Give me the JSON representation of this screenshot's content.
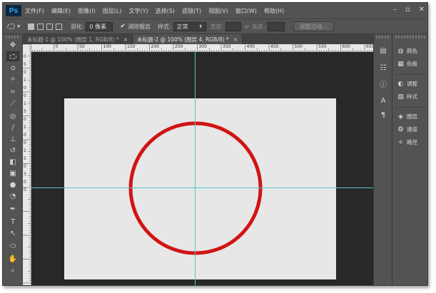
{
  "app": {
    "logo_text": "Ps"
  },
  "menubar": {
    "items": [
      "文件(F)",
      "编辑(E)",
      "图像(I)",
      "图层(L)",
      "文字(Y)",
      "选择(S)",
      "滤镜(T)",
      "视图(V)",
      "窗口(W)",
      "帮助(H)"
    ],
    "controls": {
      "minimize": "–",
      "restore": "▫",
      "close": "✕"
    }
  },
  "options": {
    "feather_label": "羽化:",
    "feather_value": "0 像素",
    "antialias_label": "消除锯齿",
    "style_label": "样式:",
    "style_value": "正常",
    "width_label": "宽度:",
    "height_label": "高度:",
    "refine_label": "调整边缘..."
  },
  "tabs": [
    {
      "label": "未标题-1 @ 100% (图层 1, RGB/8) *",
      "close": "×"
    },
    {
      "label": "未标题-2 @ 100% (图层 4, RGB/8) *",
      "close": "×"
    }
  ],
  "ruler": {
    "h_labels": [
      "50",
      "0",
      "50",
      "100",
      "150",
      "200",
      "250",
      "300",
      "350",
      "400",
      "450",
      "500",
      "550",
      "600",
      "650"
    ],
    "v_labels": [
      "0",
      "5",
      "0",
      "1",
      "0",
      "0",
      "1",
      "5",
      "0",
      "2",
      "0",
      "0",
      "2",
      "5",
      "0",
      "3",
      "0",
      "0"
    ]
  },
  "right_panel": {
    "groups": [
      [
        "颜色",
        "色板"
      ],
      [
        "调整",
        "样式"
      ],
      [
        "图层",
        "通道",
        "路径"
      ]
    ]
  },
  "colors": {
    "circle_stroke": "#d11414",
    "guide": "#52c8c8",
    "canvas": "#e7e7e7",
    "workspace": "#282828"
  }
}
